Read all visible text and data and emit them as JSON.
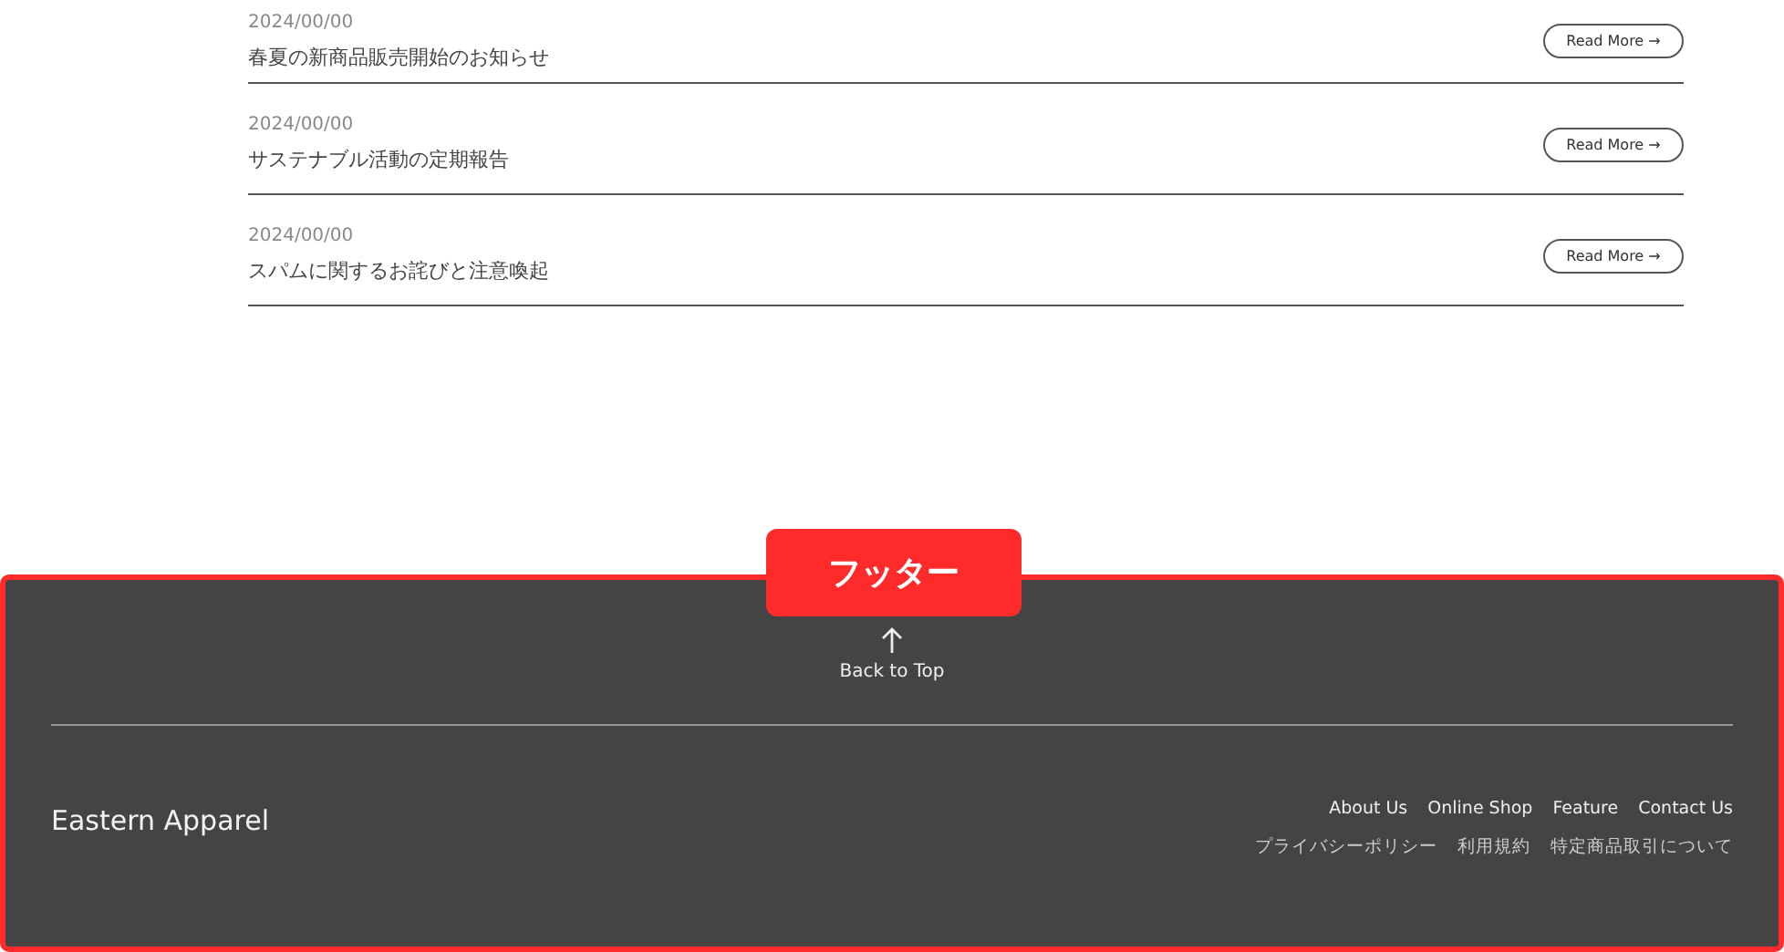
{
  "news": [
    {
      "date": "2024/00/00",
      "title": "春夏の新商品販売開始のお知らせ",
      "button": "Read More →"
    },
    {
      "date": "2024/00/00",
      "title": "サステナブル活動の定期報告",
      "button": "Read More →"
    },
    {
      "date": "2024/00/00",
      "title": "スパムに関するお詫びと注意喚起",
      "button": "Read More →"
    }
  ],
  "annotation": {
    "label": "フッター"
  },
  "footer": {
    "back_to_top": "Back to Top",
    "brand": "Eastern Apparel",
    "links": [
      "About Us",
      "Online Shop",
      "Feature",
      "Contact Us"
    ],
    "legal_links": [
      "プライバシーポリシー",
      "利用規約",
      "特定商品取引について"
    ]
  }
}
